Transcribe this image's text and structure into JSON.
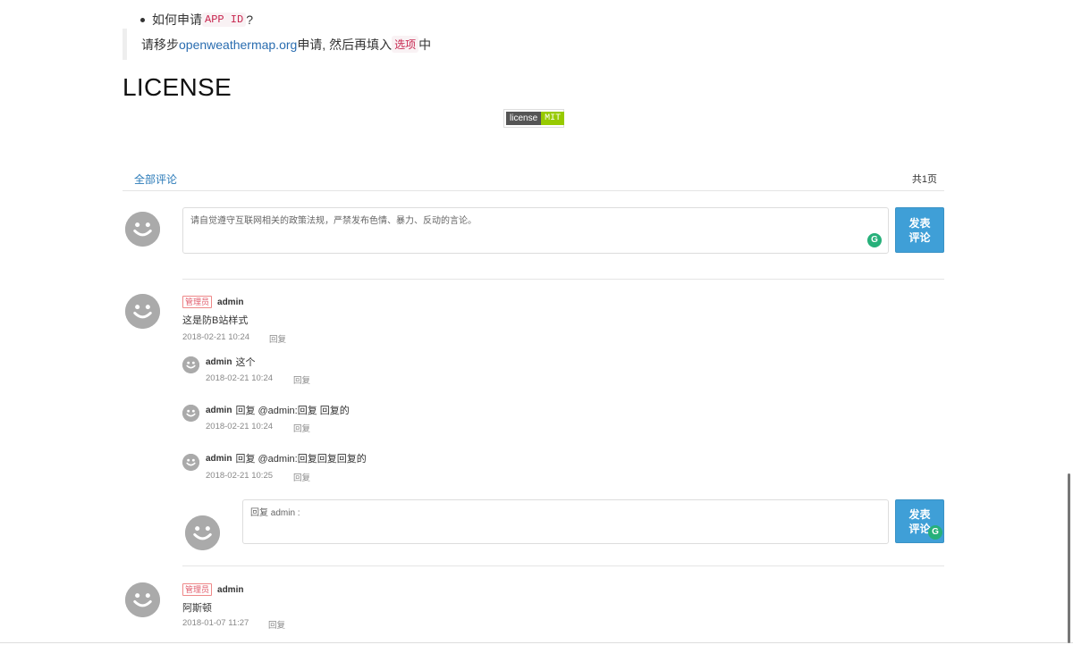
{
  "doc": {
    "bullet_prefix": "如何申请",
    "bullet_code": "APP ID",
    "bullet_suffix": "?",
    "quote_prefix": "请移步",
    "quote_link": "openweathermap.org",
    "quote_mid": " 申请, 然后再填入",
    "quote_code": "选项",
    "quote_suffix": "中",
    "license_heading": "LICENSE",
    "badge_left": "license",
    "badge_right": "MIT"
  },
  "comments_header": {
    "tab": "全部评论",
    "pages": "共1页"
  },
  "new_comment": {
    "placeholder": "请自觉遵守互联网相关的政策法规，严禁发布色情、暴力、反动的言论。",
    "button_line1": "发表",
    "button_line2": "评论"
  },
  "comments": [
    {
      "tag": "管理员",
      "user": "admin",
      "text": "这是防B站样式",
      "date": "2018-02-21 10:24",
      "reply": "回复",
      "replies": [
        {
          "user": "admin",
          "text": "这个",
          "date": "2018-02-21 10:24",
          "reply": "回复"
        },
        {
          "user": "admin",
          "text": "回复 @admin:回复 回复的",
          "date": "2018-02-21 10:24",
          "reply": "回复"
        },
        {
          "user": "admin",
          "text": "回复 @admin:回复回复回复的",
          "date": "2018-02-21 10:25",
          "reply": "回复"
        }
      ],
      "reply_box": {
        "placeholder": "回复 admin :",
        "button_line1": "发表",
        "button_line2": "评论"
      }
    },
    {
      "tag": "管理员",
      "user": "admin",
      "text": "阿斯顿",
      "date": "2018-01-07 11:27",
      "reply": "回复"
    }
  ],
  "icons": {
    "avatar": "smiley-avatar-icon",
    "grammarly": "grammarly-icon"
  },
  "colors": {
    "accent": "#3f9fd7",
    "link": "#2a7ab8",
    "admin_tag": "#e05a6a",
    "grammarly": "#27b07a"
  }
}
